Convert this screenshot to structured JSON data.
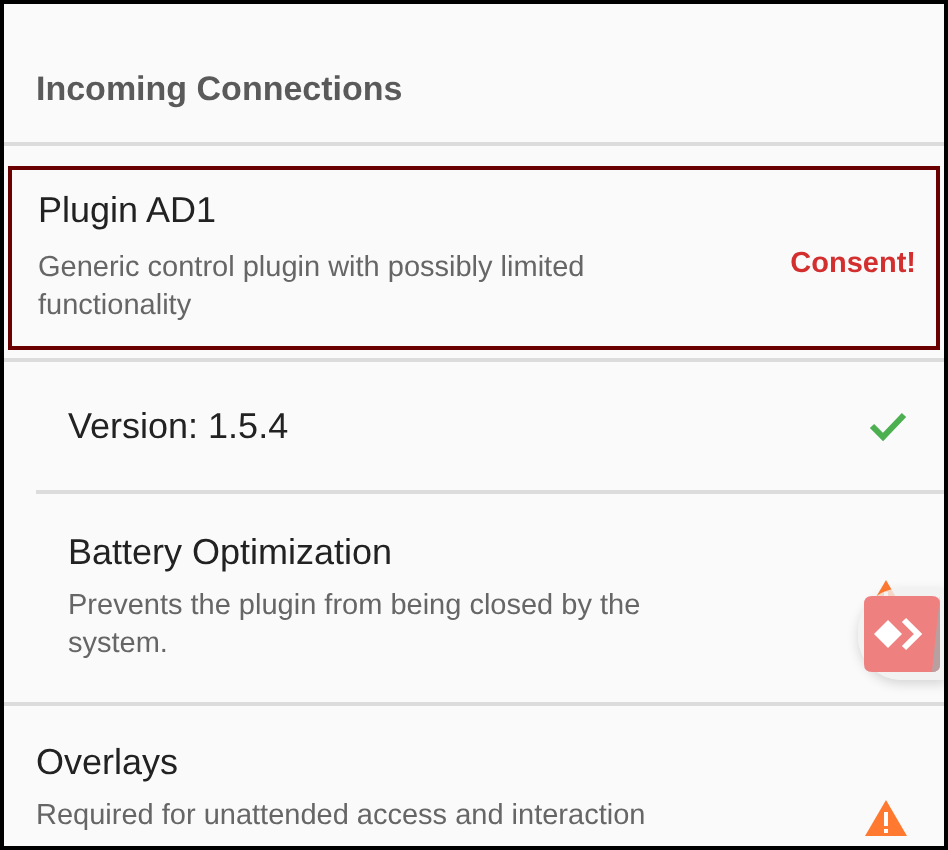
{
  "section": {
    "title": "Incoming Connections"
  },
  "plugin": {
    "title": "Plugin AD1",
    "description": "Generic control plugin with possibly limited functionality",
    "status": "Consent!",
    "highlighted": true,
    "children": [
      {
        "title": "Version: 1.5.4",
        "kind": "check"
      },
      {
        "title": "Battery Optimization",
        "description": "Prevents the plugin from being closed by the system.",
        "kind": "warning"
      }
    ]
  },
  "permissions": [
    {
      "title": "Overlays",
      "description": "Required for unattended access and interaction",
      "kind": "warning"
    }
  ]
}
